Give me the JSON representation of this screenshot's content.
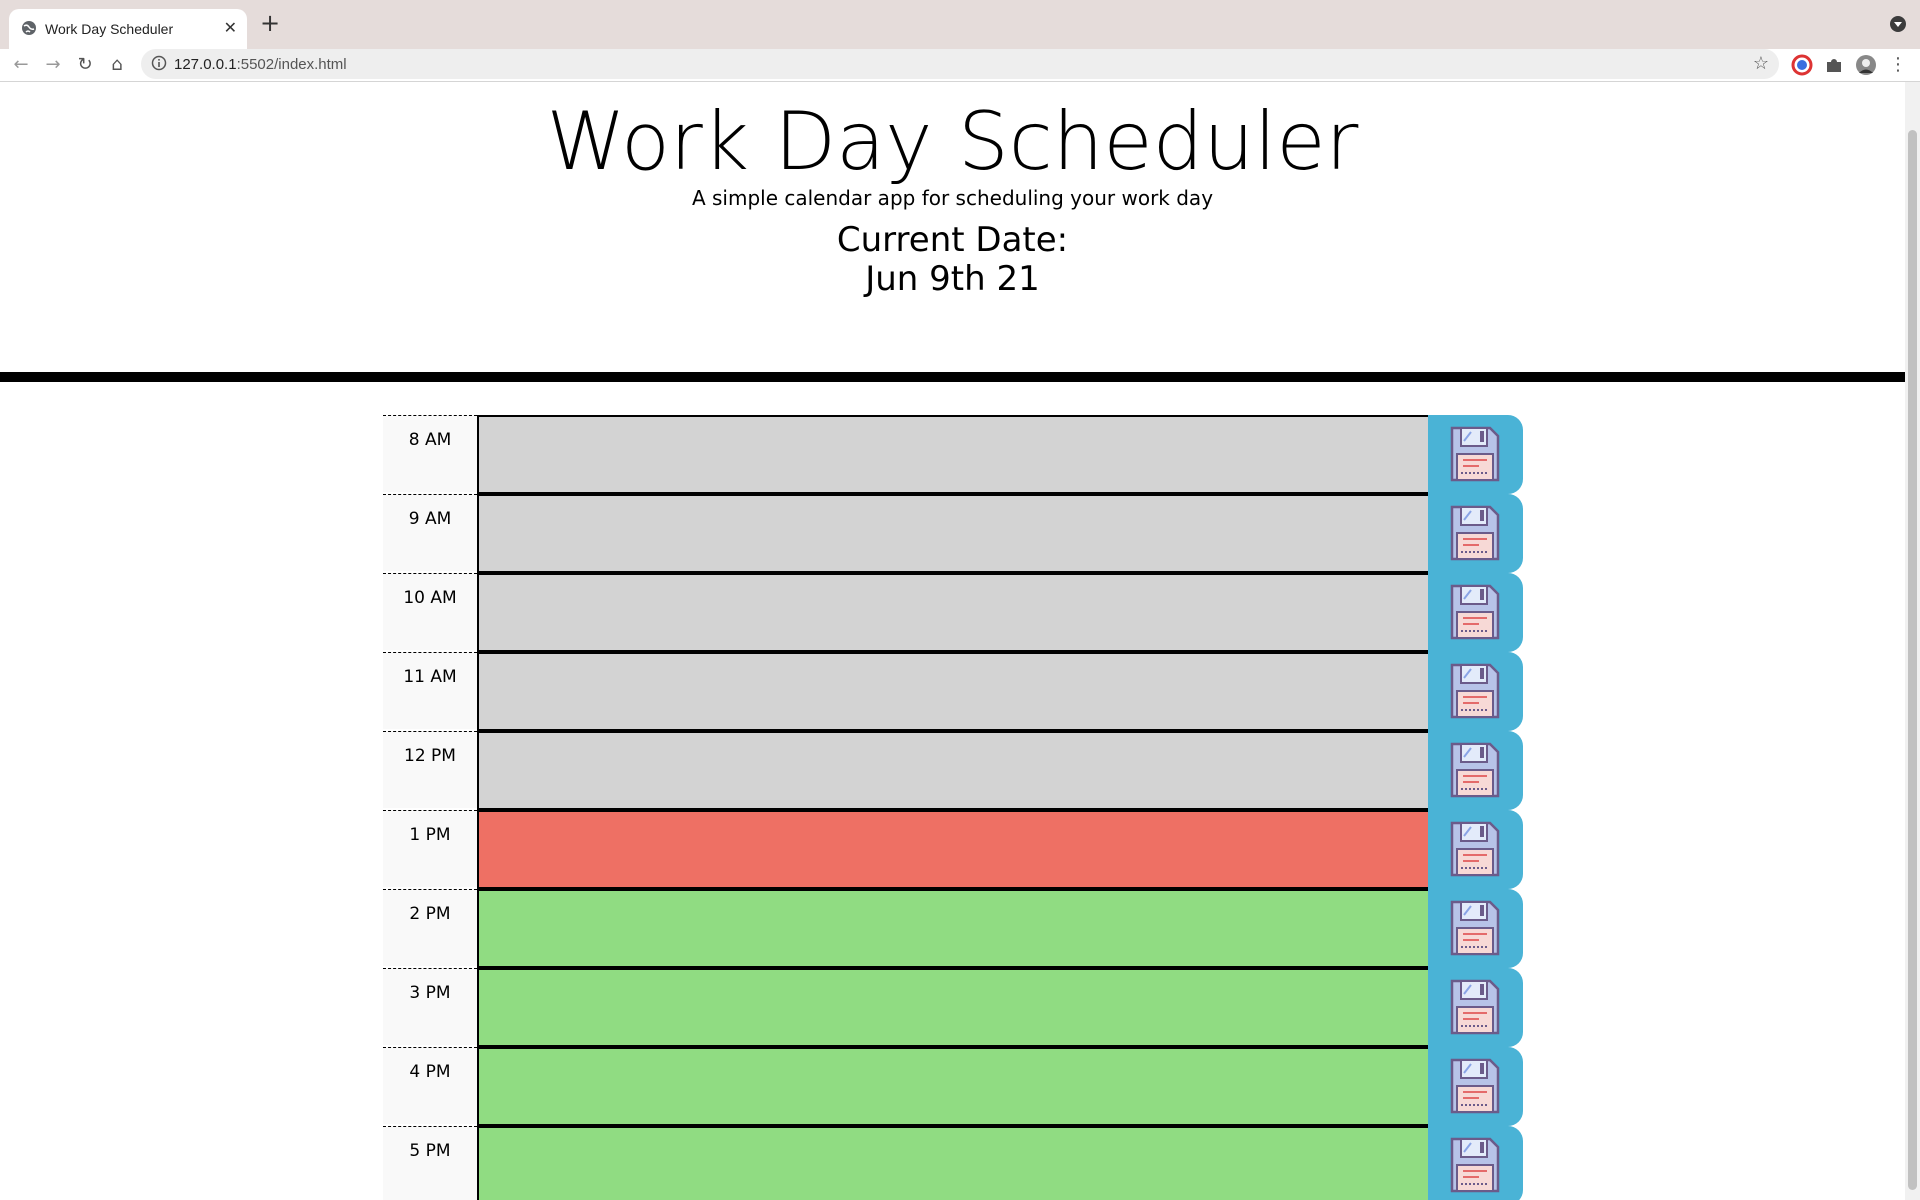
{
  "browser": {
    "tab_title": "Work Day Scheduler",
    "url_host": "127.0.0.1",
    "url_rest": ":5502/index.html"
  },
  "header": {
    "title": "Work Day Scheduler",
    "subtitle": "A simple calendar app for scheduling your work day",
    "date_label": "Current Date:",
    "date_value": "Jun 9th 21"
  },
  "colors": {
    "past": "#d3d3d3",
    "present": "#ee7064",
    "future": "#90dc82",
    "save_button": "#4ab3d6"
  },
  "hours": [
    {
      "label": "8 AM",
      "state": "past",
      "text": ""
    },
    {
      "label": "9 AM",
      "state": "past",
      "text": ""
    },
    {
      "label": "10 AM",
      "state": "past",
      "text": ""
    },
    {
      "label": "11 AM",
      "state": "past",
      "text": ""
    },
    {
      "label": "12 PM",
      "state": "past",
      "text": ""
    },
    {
      "label": "1 PM",
      "state": "present",
      "text": ""
    },
    {
      "label": "2 PM",
      "state": "future",
      "text": ""
    },
    {
      "label": "3 PM",
      "state": "future",
      "text": ""
    },
    {
      "label": "4 PM",
      "state": "future",
      "text": ""
    },
    {
      "label": "5 PM",
      "state": "future",
      "text": ""
    }
  ],
  "save_icon": "floppy-disk-icon"
}
